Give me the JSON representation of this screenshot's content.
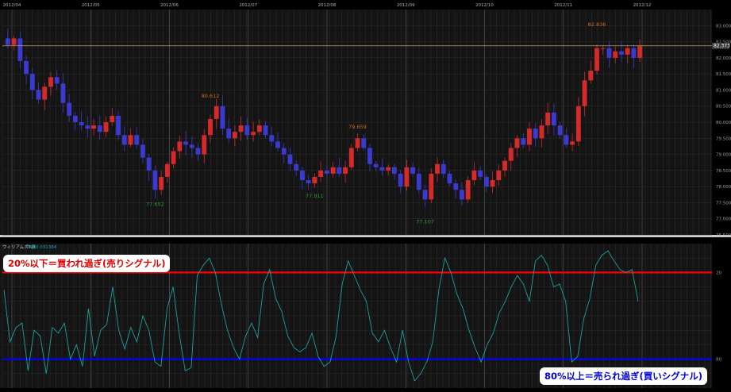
{
  "chart_data": [
    {
      "type": "candlestick",
      "x_ticks": [
        "2012/04",
        "2012/05",
        "2012/06",
        "2012/07",
        "2012/08",
        "2012/09",
        "2012/10",
        "2012/11",
        "2012/12"
      ],
      "y_ticks": [
        "83.000",
        "82.500",
        "82.000",
        "81.500",
        "81.000",
        "80.500",
        "80.000",
        "79.500",
        "79.000",
        "78.500",
        "78.000",
        "77.500",
        "77.000",
        "76.500"
      ],
      "ylim": [
        76.5,
        83.5
      ],
      "current_price": 82.373,
      "current_price_label": "82.373",
      "annotations": [
        {
          "text": "80.612",
          "type": "high"
        },
        {
          "text": "79.659",
          "type": "high"
        },
        {
          "text": "82.836",
          "type": "high"
        },
        {
          "text": "77.652",
          "type": "low"
        },
        {
          "text": "77.911",
          "type": "low"
        },
        {
          "text": "77.107",
          "type": "low"
        }
      ],
      "colors": {
        "up": "#d42a2a",
        "down": "#3a3ad0",
        "price_line": "#c8a060",
        "grid": "#2e2e2e"
      },
      "closes": [
        82.4,
        82.6,
        81.9,
        81.5,
        81.0,
        80.7,
        81.1,
        81.4,
        81.2,
        80.6,
        80.2,
        80.0,
        79.9,
        79.8,
        79.9,
        79.7,
        80.0,
        80.2,
        79.6,
        79.3,
        79.6,
        79.3,
        78.9,
        78.5,
        77.9,
        78.3,
        78.7,
        79.1,
        79.4,
        79.3,
        79.2,
        79.0,
        79.6,
        80.1,
        80.5,
        79.8,
        79.5,
        79.7,
        79.9,
        79.6,
        79.7,
        79.9,
        79.6,
        79.4,
        79.2,
        79.0,
        78.7,
        78.5,
        78.2,
        78.1,
        78.3,
        78.5,
        78.4,
        78.6,
        78.4,
        78.6,
        79.2,
        79.5,
        79.2,
        78.7,
        78.6,
        78.5,
        78.6,
        78.4,
        78.0,
        78.6,
        78.4,
        77.9,
        77.6,
        78.4,
        78.7,
        78.4,
        78.1,
        77.9,
        77.6,
        78.2,
        78.5,
        78.3,
        78.0,
        78.2,
        78.5,
        78.8,
        79.2,
        79.5,
        79.3,
        79.8,
        79.5,
        79.9,
        80.3,
        79.9,
        79.6,
        79.3,
        79.4,
        80.5,
        81.3,
        81.6,
        82.3,
        82.3,
        82.0,
        82.2,
        82.1,
        82.3,
        82.0,
        82.37
      ]
    },
    {
      "type": "line",
      "label": "ウィリアムズ%R",
      "value_label": "中値0.031384",
      "y_ticks": [
        "20",
        "80"
      ],
      "ylim": [
        -100,
        0
      ],
      "levels": [
        {
          "value": 20,
          "color": "#ff0000"
        },
        {
          "value": 80,
          "color": "#0000ff"
        }
      ],
      "line_color": "#1aa0a0",
      "values": [
        32,
        68,
        58,
        55,
        88,
        60,
        64,
        90,
        58,
        62,
        55,
        80,
        70,
        85,
        45,
        78,
        60,
        56,
        30,
        60,
        73,
        58,
        68,
        50,
        60,
        82,
        85,
        45,
        30,
        62,
        88,
        86,
        22,
        15,
        10,
        20,
        42,
        60,
        72,
        80,
        64,
        55,
        65,
        28,
        18,
        38,
        47,
        64,
        72,
        75,
        72,
        62,
        78,
        85,
        82,
        64,
        28,
        12,
        22,
        32,
        40,
        62,
        68,
        60,
        72,
        82,
        60,
        82,
        95,
        90,
        82,
        68,
        32,
        10,
        20,
        35,
        45,
        60,
        72,
        82,
        70,
        62,
        48,
        40,
        30,
        22,
        28,
        40,
        12,
        8,
        15,
        30,
        28,
        40,
        82,
        78,
        52,
        38,
        15,
        8,
        5,
        12,
        18,
        20,
        18,
        40
      ]
    }
  ],
  "callouts": {
    "sell": "20%以下＝買われ過ぎ(売りシグナル)",
    "buy": "80%以上＝売られ過ぎ(買いシグナル)"
  }
}
